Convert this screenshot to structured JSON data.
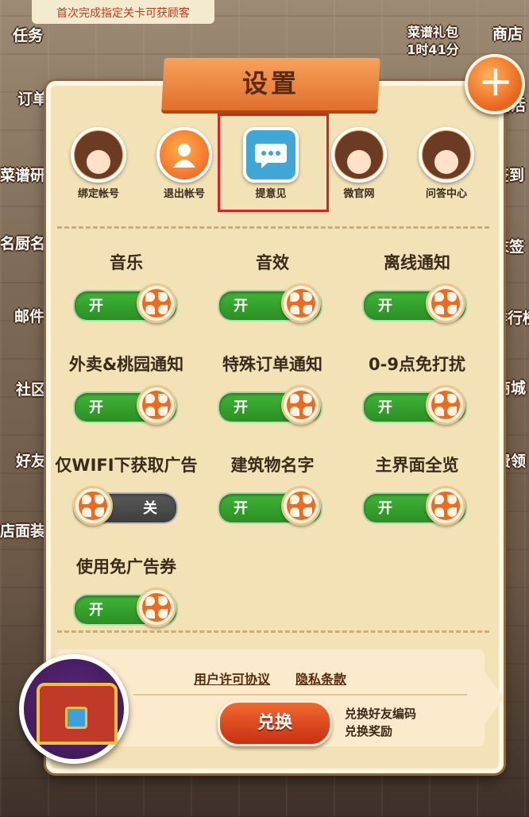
{
  "background": {
    "banner": "首次完成指定关卡可获顾客",
    "left_items": [
      "任务",
      "订单",
      "菜谱研",
      "名厨名",
      "邮件",
      "社区",
      "好友",
      "店面装"
    ],
    "right_items": [
      "商店",
      "店活",
      "签到",
      "末签",
      "排行榜",
      "商城",
      "费领"
    ],
    "recipe_gift": {
      "label": "菜谱礼包",
      "timer": "1时41分"
    }
  },
  "dialog": {
    "title": "设置",
    "close_label": "✕",
    "top_icons": [
      {
        "label": "绑定帐号",
        "icon": "avatar-icon"
      },
      {
        "label": "退出帐号",
        "icon": "user-icon"
      },
      {
        "label": "提意见",
        "icon": "chat-bubble-icon"
      },
      {
        "label": "微官网",
        "icon": "avatar-icon"
      },
      {
        "label": "问答中心",
        "icon": "avatar-icon"
      }
    ],
    "settings": [
      {
        "label": "音乐",
        "state": "开",
        "on": true
      },
      {
        "label": "音效",
        "state": "开",
        "on": true
      },
      {
        "label": "离线通知",
        "state": "开",
        "on": true
      },
      {
        "label": "外卖&桃园通知",
        "state": "开",
        "on": true
      },
      {
        "label": "特殊订单通知",
        "state": "开",
        "on": true
      },
      {
        "label": "0-9点免打扰",
        "state": "开",
        "on": true
      },
      {
        "label": "仅WIFI下获取广告",
        "state": "关",
        "on": false
      },
      {
        "label": "建筑物名字",
        "state": "开",
        "on": true
      },
      {
        "label": "主界面全览",
        "state": "开",
        "on": true
      },
      {
        "label": "使用免广告券",
        "state": "开",
        "on": true
      }
    ],
    "footer": {
      "license_link": "用户许可协议",
      "privacy_link": "隐私条款",
      "redeem_button": "兑换",
      "redeem_desc_1": "兑换好友编码",
      "redeem_desc_2": "兑换奖励"
    }
  },
  "colors": {
    "accent": "#e06f2a",
    "toggle_on": "#3fb537",
    "toggle_off": "#4a4a4a",
    "panel": "#f2e2b5",
    "highlight": "#e02020"
  }
}
